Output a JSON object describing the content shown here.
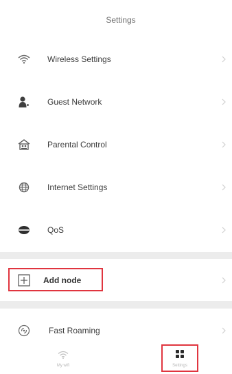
{
  "header": {
    "title": "Settings"
  },
  "menu": {
    "wireless": {
      "label": "Wireless Settings",
      "icon": "wifi-icon"
    },
    "guest": {
      "label": "Guest Network",
      "icon": "guest-user-icon"
    },
    "parental": {
      "label": "Parental Control",
      "icon": "parental-house-icon"
    },
    "internet": {
      "label": "Internet Settings",
      "icon": "globe-icon"
    },
    "qos": {
      "label": "QoS",
      "icon": "qos-icon"
    },
    "add_node": {
      "label": "Add node",
      "icon": "add-node-icon"
    },
    "fast_roaming": {
      "label": "Fast Roaming",
      "icon": "fast-roaming-icon"
    }
  },
  "tabbar": {
    "my_wifi": {
      "label": "My wifi",
      "icon": "wifi-icon"
    },
    "settings": {
      "label": "Settings",
      "icon": "settings-grid-icon"
    }
  },
  "colors": {
    "highlight": "#e0353f",
    "divider": "#ececec",
    "icon": "#4a4a4a"
  }
}
